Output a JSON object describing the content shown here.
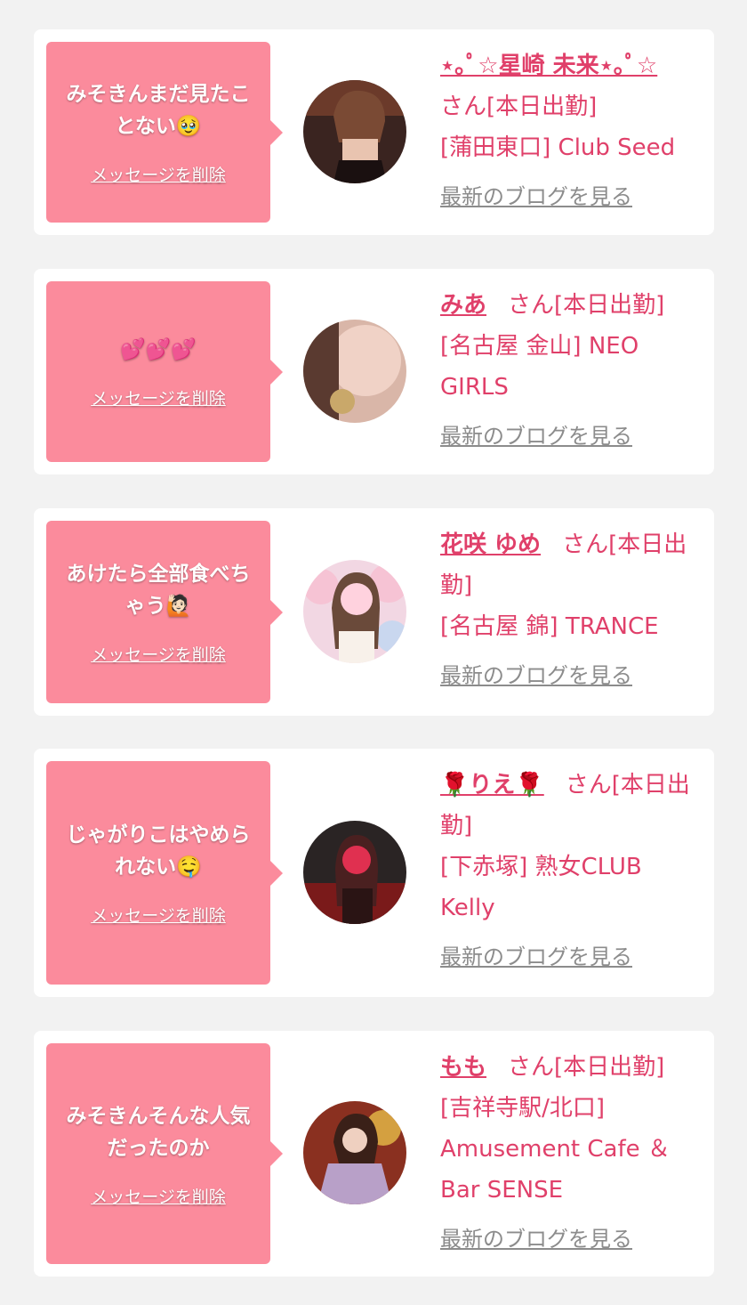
{
  "delete_label": "メッセージを削除",
  "san_label": "さん[本日出勤]",
  "blog_label": "最新のブログを見る",
  "accent_color": "#e0406a",
  "bubble_color": "#fb8b9c",
  "cards": [
    {
      "message": "みそきんまだ見たことない🥹",
      "name": "⋆｡ﾟ☆星崎 未来⋆｡ﾟ☆",
      "shop": "[蒲田東口] Club Seed"
    },
    {
      "message": "💕💕💕",
      "name": "みあ",
      "shop": "[名古屋 金山] NEO GIRLS"
    },
    {
      "message": "あけたら全部食べちゃう🙋🏻",
      "name": "花咲 ゆめ",
      "shop": "[名古屋 錦] TRANCE"
    },
    {
      "message": "じゃがりこはやめられない🤤",
      "name": "🌹りえ🌹",
      "shop": "[下赤塚] 熟女CLUB Kelly"
    },
    {
      "message": "みそきんそんな人気だったのか",
      "name": "もも",
      "shop": "[吉祥寺駅/北口] Amusement Cafe ＆Bar SENSE"
    }
  ]
}
